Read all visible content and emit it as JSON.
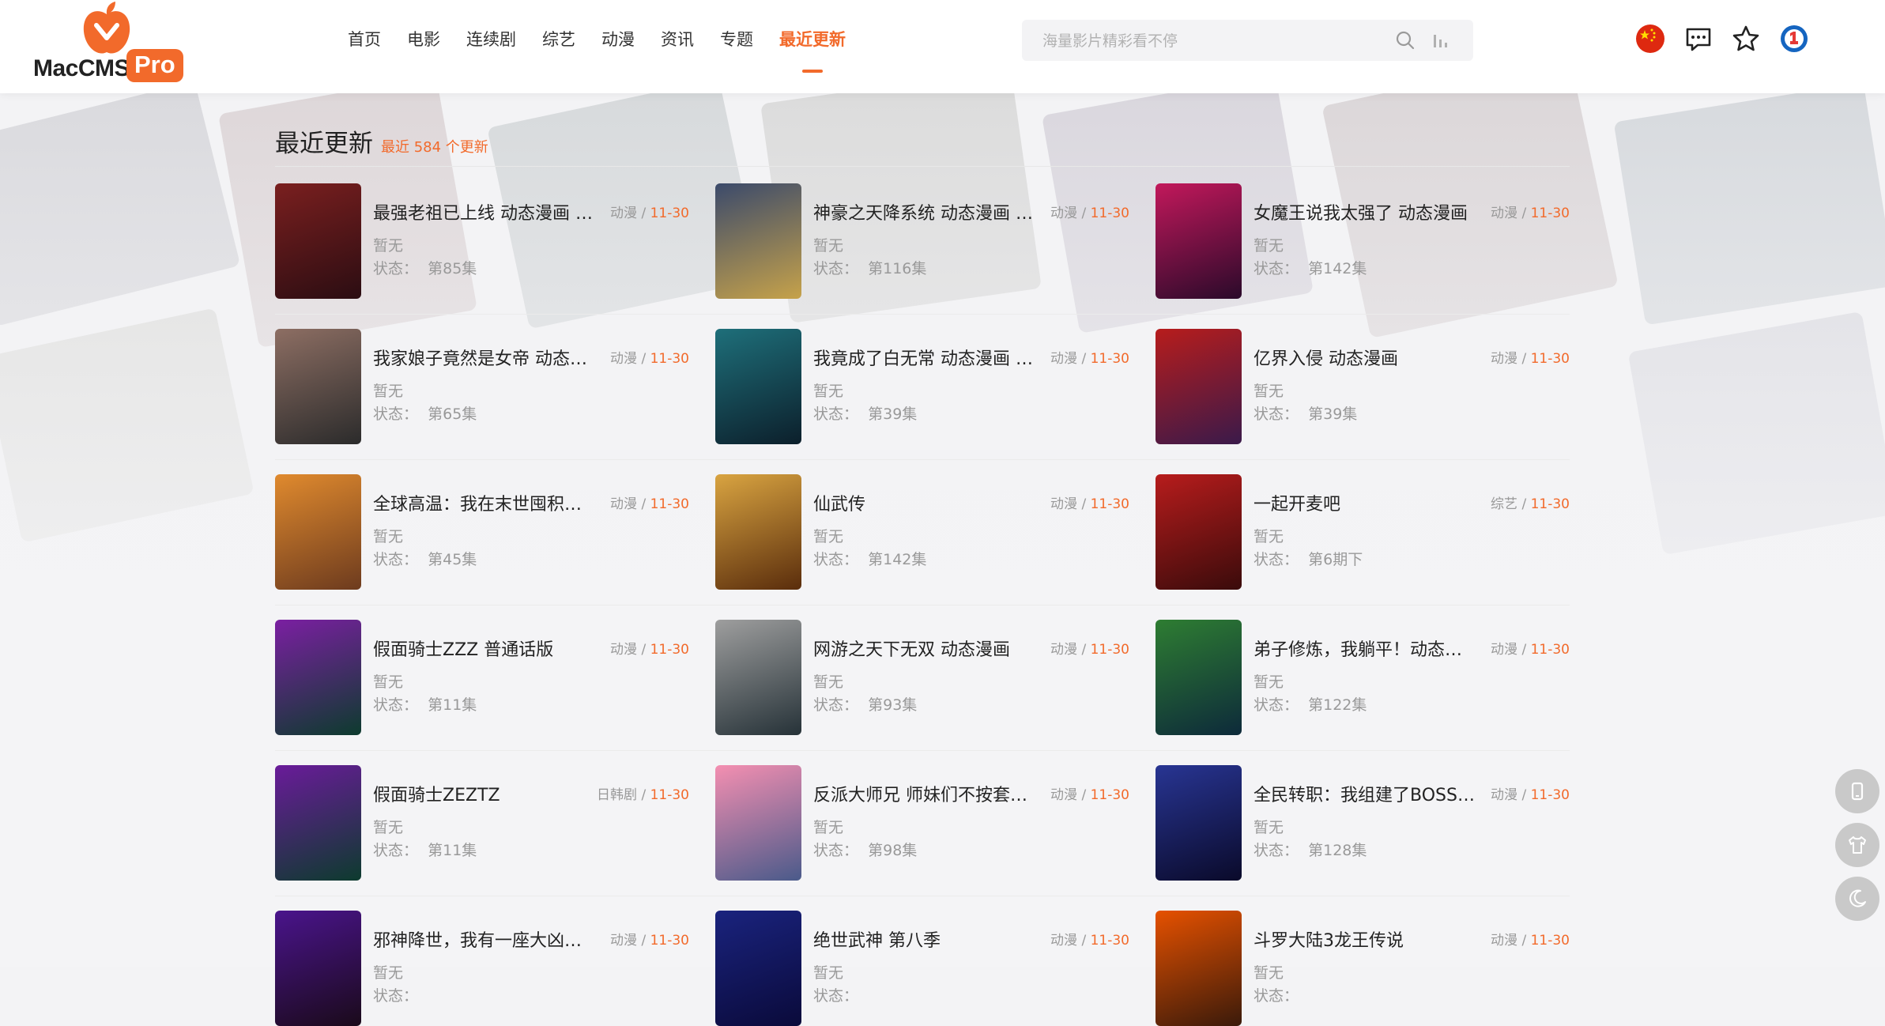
{
  "brand": {
    "text": "MacCMS",
    "pro": "Pro",
    "accent": "#f26a2b"
  },
  "nav": [
    {
      "label": "首页",
      "active": false
    },
    {
      "label": "电影",
      "active": false
    },
    {
      "label": "连续剧",
      "active": false
    },
    {
      "label": "综艺",
      "active": false
    },
    {
      "label": "动漫",
      "active": false
    },
    {
      "label": "资讯",
      "active": false
    },
    {
      "label": "专题",
      "active": false
    },
    {
      "label": "最近更新",
      "active": true
    }
  ],
  "search": {
    "placeholder": "海量影片精彩看不停"
  },
  "header_icons": [
    "china-flag-icon",
    "message-icon",
    "star-icon",
    "user-badge-icon"
  ],
  "page": {
    "title": "最近更新",
    "subtitle": "最近 584 个更新"
  },
  "items": [
    {
      "title": "最强老祖已上线 动态漫画 第二季",
      "category": "动漫",
      "date": "11-30",
      "actor": "暂无",
      "status_label": "状态：",
      "status": "第85集",
      "colors": [
        "#7a1f1f",
        "#2b0d12"
      ]
    },
    {
      "title": "神豪之天降系统 动态漫画 第二季",
      "category": "动漫",
      "date": "11-30",
      "actor": "暂无",
      "status_label": "状态：",
      "status": "第116集",
      "colors": [
        "#3b4a6b",
        "#c6a24a"
      ]
    },
    {
      "title": "女魔王说我太强了 动态漫画",
      "category": "动漫",
      "date": "11-30",
      "actor": "暂无",
      "status_label": "状态：",
      "status": "第142集",
      "colors": [
        "#c2185b",
        "#2a0a2a"
      ]
    },
    {
      "title": "我家娘子竟然是女帝 动态漫画",
      "category": "动漫",
      "date": "11-30",
      "actor": "暂无",
      "status_label": "状态：",
      "status": "第65集",
      "colors": [
        "#8d6e63",
        "#2b2b2b"
      ]
    },
    {
      "title": "我竟成了白无常 动态漫画 第二季",
      "category": "动漫",
      "date": "11-30",
      "actor": "暂无",
      "status_label": "状态：",
      "status": "第39集",
      "colors": [
        "#1e6f7a",
        "#0c1f2b"
      ]
    },
    {
      "title": "亿界入侵 动态漫画",
      "category": "动漫",
      "date": "11-30",
      "actor": "暂无",
      "status_label": "状态：",
      "status": "第39集",
      "colors": [
        "#b71c1c",
        "#3a1a4a"
      ]
    },
    {
      "title": "全球高温：我在末世囤积百亿物资",
      "category": "动漫",
      "date": "11-30",
      "actor": "暂无",
      "status_label": "状态：",
      "status": "第45集",
      "colors": [
        "#e08a2e",
        "#6d3b1e"
      ]
    },
    {
      "title": "仙武传",
      "category": "动漫",
      "date": "11-30",
      "actor": "暂无",
      "status_label": "状态：",
      "status": "第142集",
      "colors": [
        "#d9a441",
        "#5a2d0c"
      ]
    },
    {
      "title": "一起开麦吧",
      "category": "综艺",
      "date": "11-30",
      "actor": "暂无",
      "status_label": "状态：",
      "status": "第6期下",
      "colors": [
        "#b71c1c",
        "#3a0b0b"
      ]
    },
    {
      "title": "假面骑士ZZZ 普通话版",
      "category": "动漫",
      "date": "11-30",
      "actor": "暂无",
      "status_label": "状态：",
      "status": "第11集",
      "colors": [
        "#7b1fa2",
        "#0d3b2e"
      ]
    },
    {
      "title": "网游之天下无双 动态漫画",
      "category": "动漫",
      "date": "11-30",
      "actor": "暂无",
      "status_label": "状态：",
      "status": "第93集",
      "colors": [
        "#9e9e9e",
        "#263238"
      ]
    },
    {
      "title": "弟子修炼，我躺平！动态漫画",
      "category": "动漫",
      "date": "11-30",
      "actor": "暂无",
      "status_label": "状态：",
      "status": "第122集",
      "colors": [
        "#2e7d32",
        "#0d2a3a"
      ]
    },
    {
      "title": "假面骑士ZEZTZ",
      "category": "日韩剧",
      "date": "11-30",
      "actor": "暂无",
      "status_label": "状态：",
      "status": "第11集",
      "colors": [
        "#6a1b9a",
        "#0d3b2e"
      ]
    },
    {
      "title": "反派大师兄 师妹们不按套路出牌",
      "category": "动漫",
      "date": "11-30",
      "actor": "暂无",
      "status_label": "状态：",
      "status": "第98集",
      "colors": [
        "#f48fb1",
        "#4a5a8a"
      ]
    },
    {
      "title": "全民转职：我组建了BOSS军团",
      "category": "动漫",
      "date": "11-30",
      "actor": "暂无",
      "status_label": "状态：",
      "status": "第128集",
      "colors": [
        "#283593",
        "#0a0a2a"
      ]
    },
    {
      "title": "邪神降世，我有一座大凶狱 动态漫画",
      "category": "动漫",
      "date": "11-30",
      "actor": "暂无",
      "status_label": "状态：",
      "status": "",
      "colors": [
        "#4a148c",
        "#1a0a1a"
      ]
    },
    {
      "title": "绝世武神 第八季",
      "category": "动漫",
      "date": "11-30",
      "actor": "暂无",
      "status_label": "状态：",
      "status": "",
      "colors": [
        "#1a237e",
        "#0a0a3a"
      ]
    },
    {
      "title": "斗罗大陆3龙王传说",
      "category": "动漫",
      "date": "11-30",
      "actor": "暂无",
      "status_label": "状态：",
      "status": "",
      "colors": [
        "#e65100",
        "#3a1a0a"
      ]
    }
  ],
  "float_buttons": [
    "phone-icon",
    "shirt-icon",
    "moon-icon"
  ]
}
